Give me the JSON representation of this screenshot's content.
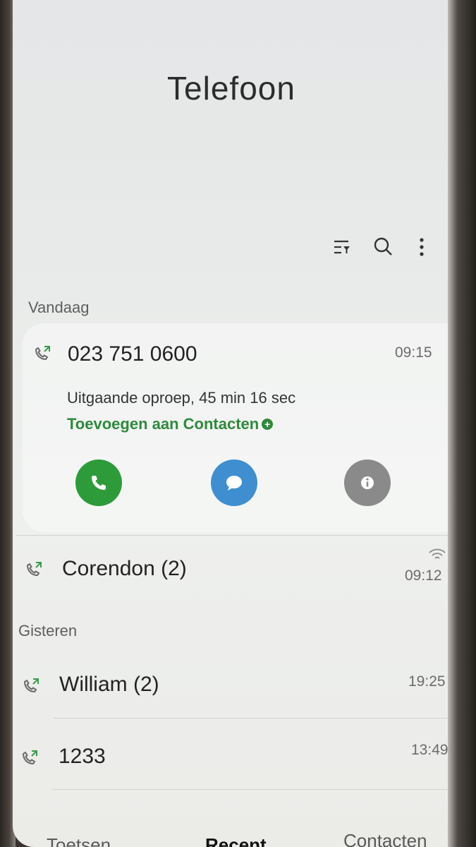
{
  "app": {
    "title": "Telefoon"
  },
  "toolbar": {
    "filter_icon": "filter-icon",
    "search_icon": "search-icon",
    "more_icon": "more-vertical-icon"
  },
  "sections": {
    "today": "Vandaag",
    "yesterday": "Gisteren"
  },
  "expanded_entry": {
    "number": "023 751 0600",
    "time": "09:15",
    "detail": "Uitgaande oproep, 45 min 16 sec",
    "add_to_contacts": "Toevoegen aan Contacten",
    "actions": {
      "call_color": "#2e9b3a",
      "message_color": "#3f8fd0",
      "info_color": "#8a8a8a"
    }
  },
  "entries": [
    {
      "name": "Corendon (2)",
      "time": "09:12",
      "wifi_call": true
    },
    {
      "name": "William (2)",
      "time": "19:25"
    },
    {
      "name": "1233",
      "time": "13:49"
    }
  ],
  "nav": {
    "keypad": "Toetsen",
    "recent": "Recent",
    "contacts": "Contacten"
  }
}
